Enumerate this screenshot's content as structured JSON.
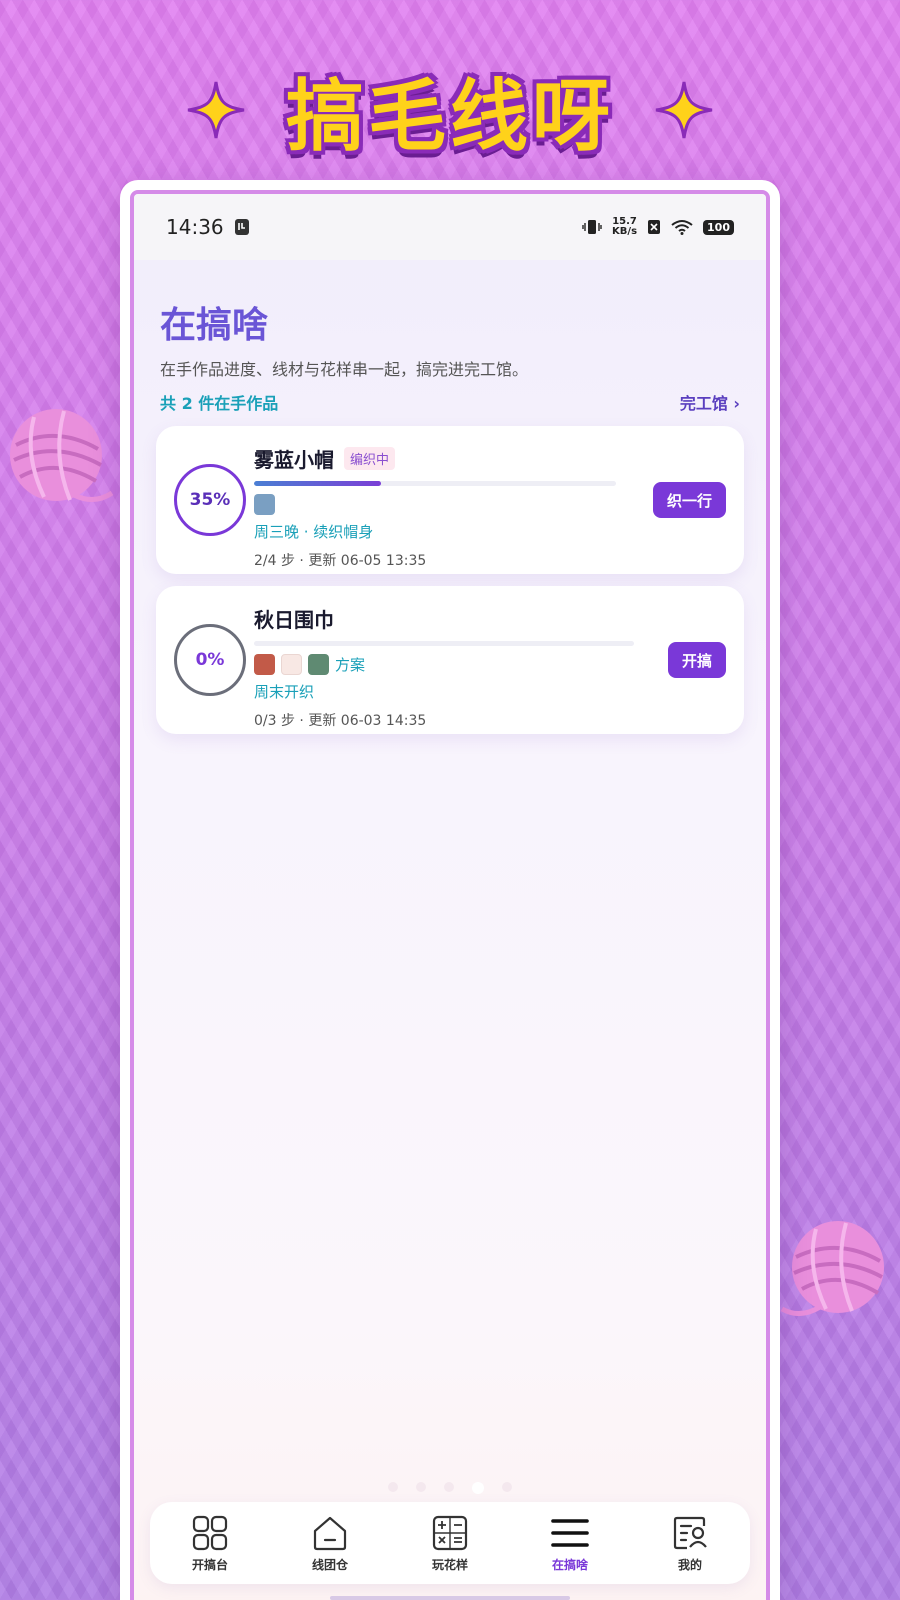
{
  "banner": {
    "title": "搞毛线呀"
  },
  "status_bar": {
    "time": "14:36",
    "net_speed_value": "15.7",
    "net_speed_unit": "KB/s",
    "battery": "100"
  },
  "header": {
    "title": "在搞啥",
    "subtitle": "在手作品进度、线材与花样串一起，搞完进完工馆。",
    "count_text": "共 2 件在手作品",
    "gallery_link": "完工馆 ›"
  },
  "projects": [
    {
      "name": "雾蓝小帽",
      "progress_label": "35%",
      "progress": 0.35,
      "status_badge": "编织中",
      "swatch_colors": [
        "#7a9fc2"
      ],
      "plan_label": "",
      "plan": "周三晚 · 续织帽身",
      "meta": "2/4 步 · 更新 06-05 13:35",
      "action": "织一行",
      "ring_color": "#7a38d8"
    },
    {
      "name": "秋日围巾",
      "progress_label": "0%",
      "progress": 0,
      "status_badge": "",
      "swatch_colors": [
        "#c25a48",
        "#f8e8e4",
        "#5f8a72"
      ],
      "plan_label": "方案",
      "plan": "周末开织",
      "meta": "0/3 步 · 更新 06-03 14:35",
      "action": "开搞",
      "ring_color": "#6b6e7a"
    }
  ],
  "tabs": [
    {
      "label": "开搞台",
      "icon": "grid-icon",
      "active": false
    },
    {
      "label": "线团仓",
      "icon": "home-icon",
      "active": false
    },
    {
      "label": "玩花样",
      "icon": "calculator-icon",
      "active": false
    },
    {
      "label": "在搞啥",
      "icon": "menu-icon",
      "active": true
    },
    {
      "label": "我的",
      "icon": "profile-card-icon",
      "active": false
    }
  ],
  "colors": {
    "accent": "#7a38d8",
    "title": "#6a55d6",
    "teal": "#1aa0b8",
    "banner_yellow": "#ffd21a"
  }
}
